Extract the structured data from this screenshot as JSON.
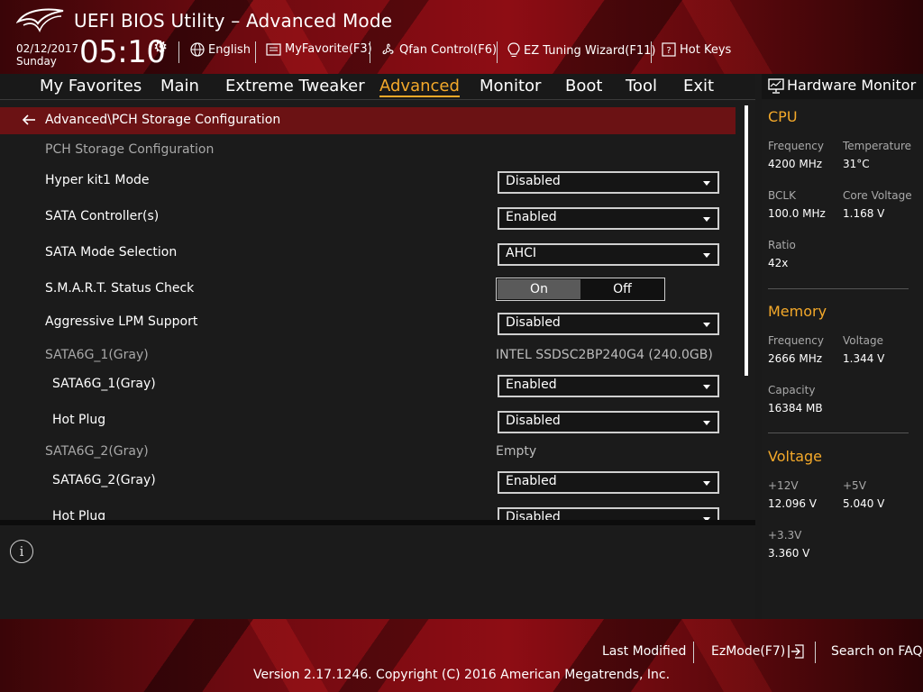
{
  "header": {
    "title": "UEFI BIOS Utility – Advanced Mode",
    "date": "02/12/2017",
    "day": "Sunday",
    "time": "05:10",
    "tools": {
      "language": "English",
      "favorite": "MyFavorite(F3)",
      "qfan": "Qfan Control(F6)",
      "ez_tuning": "EZ Tuning Wizard(F11)",
      "hot_keys": "Hot Keys"
    }
  },
  "nav": {
    "items": [
      "My Favorites",
      "Main",
      "Extreme Tweaker",
      "Advanced",
      "Monitor",
      "Boot",
      "Tool",
      "Exit"
    ],
    "active": "Advanced"
  },
  "breadcrumb": "Advanced\\PCH Storage Configuration",
  "settings": {
    "section_title": "PCH Storage Configuration",
    "hyper_kit": {
      "label": "Hyper kit1 Mode",
      "value": "Disabled"
    },
    "sata_controller": {
      "label": "SATA Controller(s)",
      "value": "Enabled"
    },
    "sata_mode": {
      "label": "SATA Mode Selection",
      "value": "AHCI"
    },
    "smart": {
      "label": "S.M.A.R.T. Status Check",
      "on": "On",
      "off": "Off",
      "selected": "On"
    },
    "lpm": {
      "label": "Aggressive LPM Support",
      "value": "Disabled"
    },
    "sata1_header": {
      "label": "SATA6G_1(Gray)",
      "device": "INTEL SSDSC2BP240G4 (240.0GB)"
    },
    "sata1_port": {
      "label": "SATA6G_1(Gray)",
      "value": "Enabled"
    },
    "sata1_hotplug": {
      "label": "Hot Plug",
      "value": "Disabled"
    },
    "sata2_header": {
      "label": "SATA6G_2(Gray)",
      "device": "Empty"
    },
    "sata2_port": {
      "label": "SATA6G_2(Gray)",
      "value": "Enabled"
    },
    "sata2_hotplug": {
      "label": "Hot Plug",
      "value": "Disabled"
    }
  },
  "hardware_monitor": {
    "title": "Hardware Monitor",
    "cpu": {
      "title": "CPU",
      "frequency_label": "Frequency",
      "frequency": "4200 MHz",
      "temperature_label": "Temperature",
      "temperature": "31°C",
      "bclk_label": "BCLK",
      "bclk": "100.0 MHz",
      "core_voltage_label": "Core Voltage",
      "core_voltage": "1.168 V",
      "ratio_label": "Ratio",
      "ratio": "42x"
    },
    "memory": {
      "title": "Memory",
      "frequency_label": "Frequency",
      "frequency": "2666 MHz",
      "voltage_label": "Voltage",
      "voltage": "1.344 V",
      "capacity_label": "Capacity",
      "capacity": "16384 MB"
    },
    "voltage": {
      "title": "Voltage",
      "v12_label": "+12V",
      "v12": "12.096 V",
      "v5_label": "+5V",
      "v5": "5.040 V",
      "v33_label": "+3.3V",
      "v33": "3.360 V"
    }
  },
  "footer": {
    "last_modified": "Last Modified",
    "ez_mode": "EzMode(F7)",
    "search_faq": "Search on FAQ",
    "version": "Version 2.17.1246. Copyright (C) 2016 American Megatrends, Inc."
  },
  "colors": {
    "accent": "#f4a92a",
    "breadcrumb_bg": "#6b1214",
    "panel_bg": "#1b1b1b"
  }
}
